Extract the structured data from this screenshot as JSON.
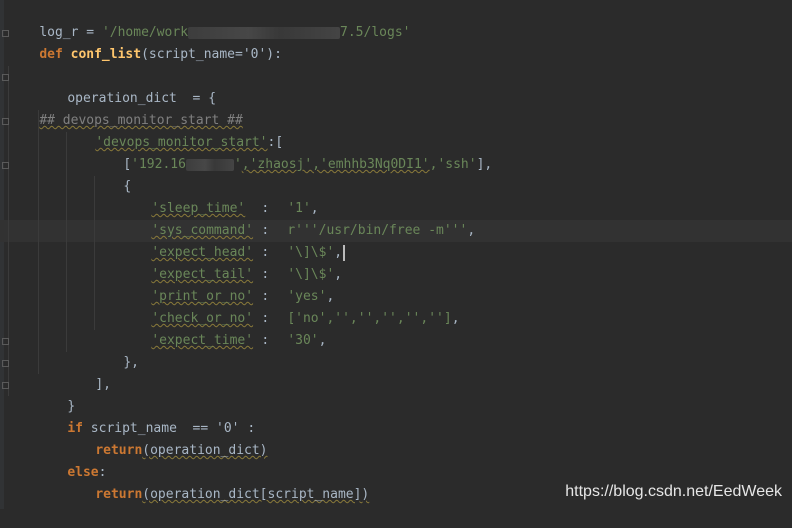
{
  "code": {
    "l1_var": "log_r",
    "l1_eq": " = ",
    "l1_str_a": "'/home/work",
    "l1_str_b": "7.5/logs'",
    "l2_def": "def",
    "l2_fn": "conf_list",
    "l2_params": "(script_name='0'):",
    "l4_text": "operation_dict  = {",
    "l5_comment": "## devops_monitor_start ##",
    "l6_key": "'devops_monitor_start'",
    "l6_rest": ":[",
    "l7_open": "[",
    "l7_ip_a": "'192.16",
    "l7_ip_b": "'",
    "l7_user": ",'zhaosj'",
    "l7_pass": ",'emhhb3Nq0DI1'",
    "l7_proto": ",'ssh'",
    "l7_close": "],",
    "l8": "{",
    "l9_key": "'sleep_time'",
    "l9_val": "'1'",
    "l10_key": "'sys_command'",
    "l10_val": "r'''/usr/bin/free -m'''",
    "l11_key": "'expect_head'",
    "l11_val": "'\\]\\$'",
    "l12_key": "'expect_tail'",
    "l12_val": "'\\]\\$'",
    "l13_key": "'print_or_no'",
    "l13_val": "'yes'",
    "l14_key": "'check_or_no'",
    "l14_val": "['no','','','','','']",
    "l15_key": "'expect_time'",
    "l15_val": "'30'",
    "colon": ":",
    "comma": ",",
    "l16": "},",
    "l17": "],",
    "l18": "}",
    "l19_if": "if",
    "l19_rest": "script_name  == '0' :",
    "l20_return": "return",
    "l20_rest": "(operation_dict)",
    "l21_else": "else",
    "l21_colon": ":",
    "l22_return": "return",
    "l22_rest": "(operation_dict[script_name])"
  },
  "watermark": "https://blog.csdn.net/EedWeek"
}
